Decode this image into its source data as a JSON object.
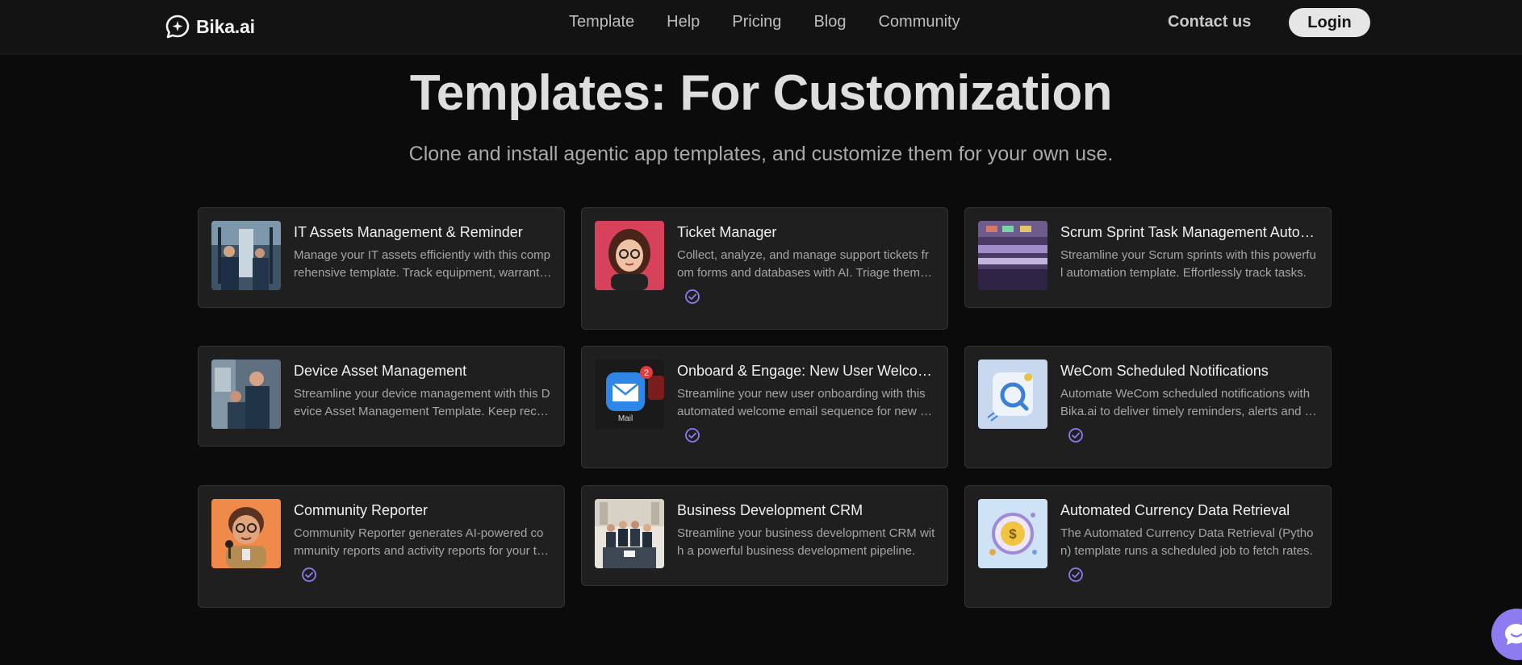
{
  "brand": {
    "name": "Bika.ai",
    "logo_icon": "chat-sparkle-icon"
  },
  "nav": {
    "links": [
      "Template",
      "Help",
      "Pricing",
      "Blog",
      "Community"
    ],
    "contact_label": "Contact us",
    "login_label": "Login"
  },
  "hero": {
    "title": "Templates: For Customization",
    "subtitle": "Clone and install agentic app templates, and customize them for your own use."
  },
  "colors": {
    "accent": "#8d7cf0",
    "card_bg": "#1f1f1f",
    "page_bg": "#0b0b0b"
  },
  "templates": [
    {
      "title": "IT Assets Management & Reminder",
      "description": "Manage your IT assets efficiently with this comprehensive template. Track equipment, warranties and maintenance.",
      "verified": false,
      "thumbnail": "it-workers-photo"
    },
    {
      "title": "Ticket Manager",
      "description": "Collect, analyze, and manage support tickets from forms and databases with AI. Triage them faster.",
      "verified": true,
      "thumbnail": "woman-avatar-illustration"
    },
    {
      "title": "Scrum Sprint Task Management Automation",
      "description": "Streamline your Scrum sprints with this powerful automation template. Effortlessly track tasks.",
      "verified": false,
      "thumbnail": "sprint-board-photo"
    },
    {
      "title": "Device Asset Management",
      "description": "Streamline your device management with this Device Asset Management Template. Keep records accurate.",
      "verified": false,
      "thumbnail": "technicians-photo"
    },
    {
      "title": "Onboard & Engage: New User Welcome",
      "description": "Streamline your new user onboarding with this automated welcome email sequence for new members.",
      "verified": true,
      "thumbnail": "mail-app-icon"
    },
    {
      "title": "WeCom Scheduled Notifications",
      "description": "Automate WeCom scheduled notifications with Bika.ai to deliver timely reminders, alerts and updates.",
      "verified": true,
      "thumbnail": "notification-icon-illustration"
    },
    {
      "title": "Community Reporter",
      "description": "Community Reporter generates AI-powered community reports and activity reports for your team.",
      "verified": true,
      "thumbnail": "reporter-cartoon"
    },
    {
      "title": "Business Development CRM",
      "description": "Streamline your business development CRM with a powerful business development pipeline.",
      "verified": false,
      "thumbnail": "business-team-photo"
    },
    {
      "title": "Automated Currency Data Retrieval",
      "description": "The Automated Currency Data Retrieval (Python) template runs a scheduled job to fetch rates.",
      "verified": true,
      "thumbnail": "currency-coin-illustration"
    }
  ],
  "chat_widget": {
    "icon": "chat-bubble-icon"
  }
}
